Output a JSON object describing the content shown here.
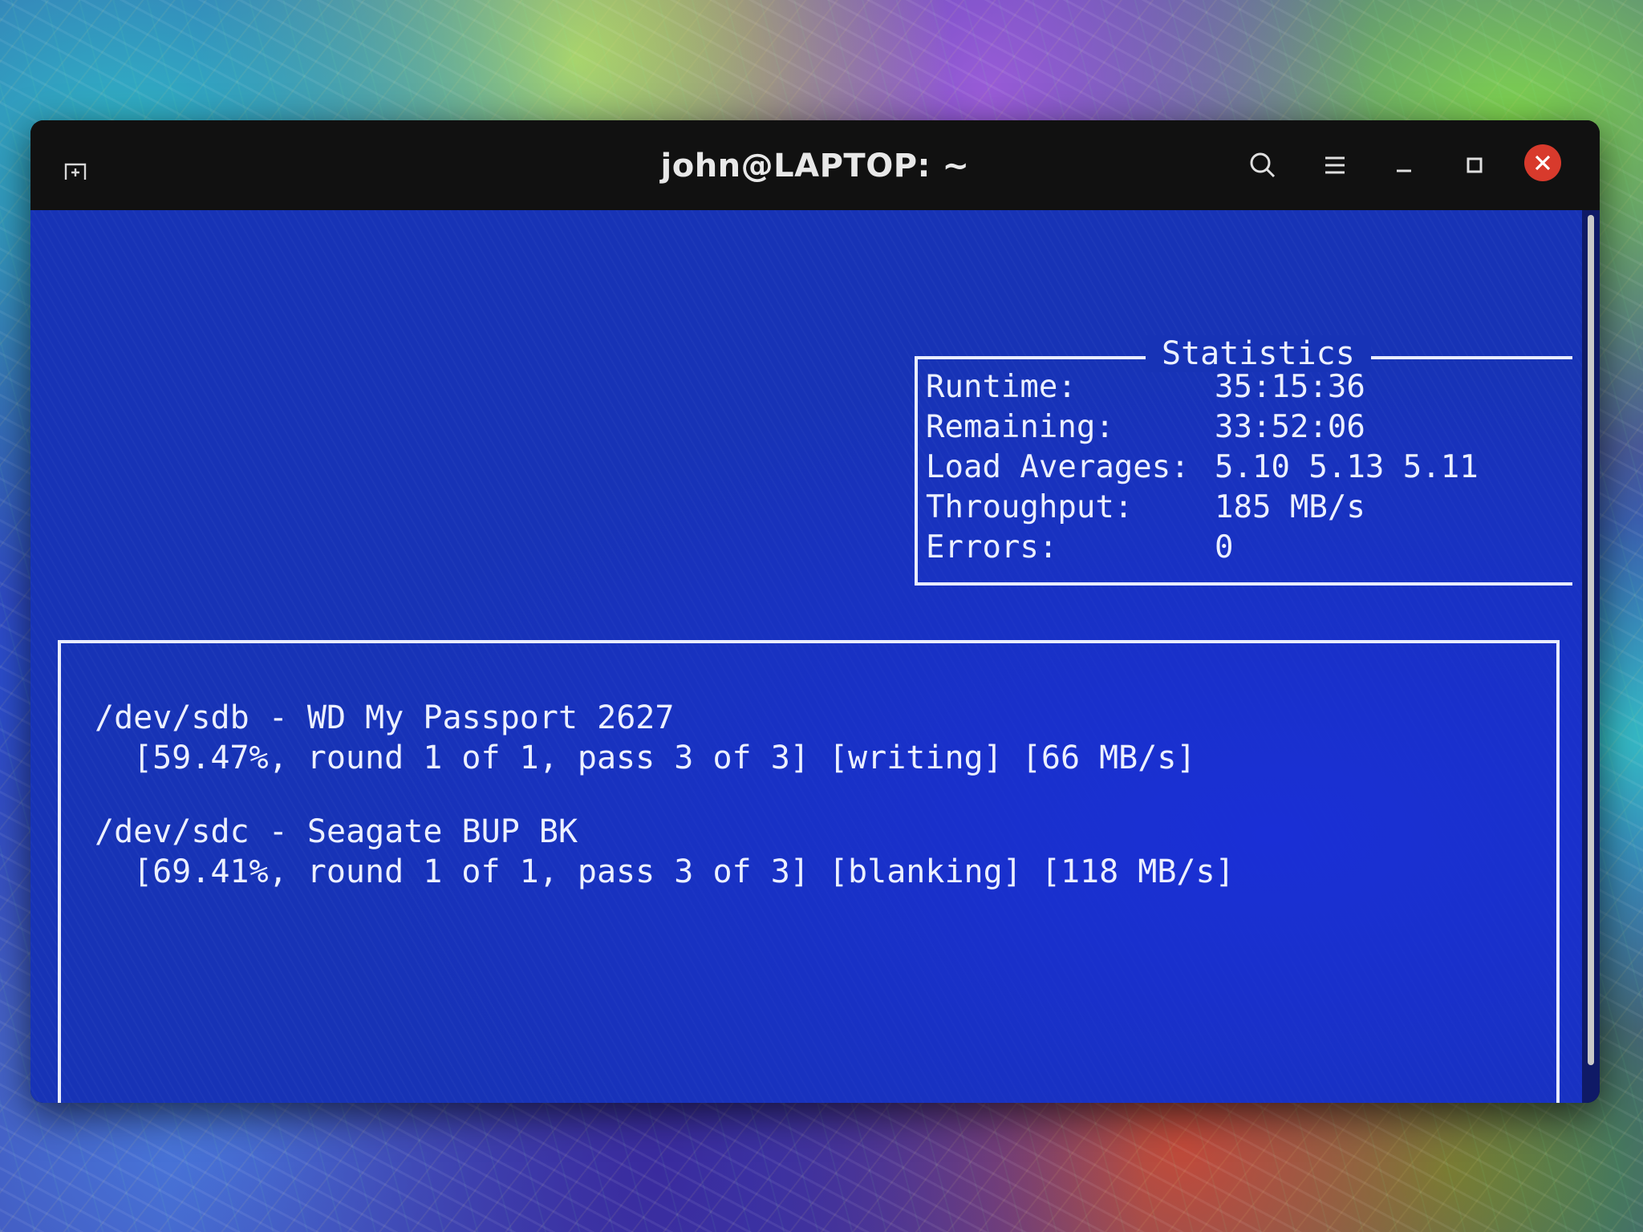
{
  "window": {
    "title": "john@LAPTOP: ~"
  },
  "statistics": {
    "title": "Statistics",
    "rows": [
      {
        "label": "Runtime:",
        "value": "35:15:36"
      },
      {
        "label": "Remaining:",
        "value": "33:52:06"
      },
      {
        "label": "Load Averages:",
        "value": "5.10 5.13 5.11"
      },
      {
        "label": "Throughput:",
        "value": "185 MB/s"
      },
      {
        "label": "Errors:",
        "value": "0"
      }
    ]
  },
  "devices": [
    {
      "name": "/dev/sdb - WD My Passport 2627",
      "status": "[59.47%, round 1 of 1, pass 3 of 3] [writing] [66 MB/s]"
    },
    {
      "name": "/dev/sdc - Seagate BUP BK",
      "status": "[69.41%, round 1 of 1, pass 3 of 3] [blanking] [118 MB/s]"
    }
  ],
  "icons": {
    "new_tab": "new-tab-icon",
    "search": "search-icon",
    "menu": "hamburger-menu-icon",
    "minimize": "minimize-icon",
    "maximize": "maximize-icon",
    "close": "close-icon"
  },
  "colors": {
    "terminal_background": "#1733b6",
    "terminal_text": "#ecf0ff",
    "titlebar": "#111111",
    "close_button": "#d83a2c"
  }
}
